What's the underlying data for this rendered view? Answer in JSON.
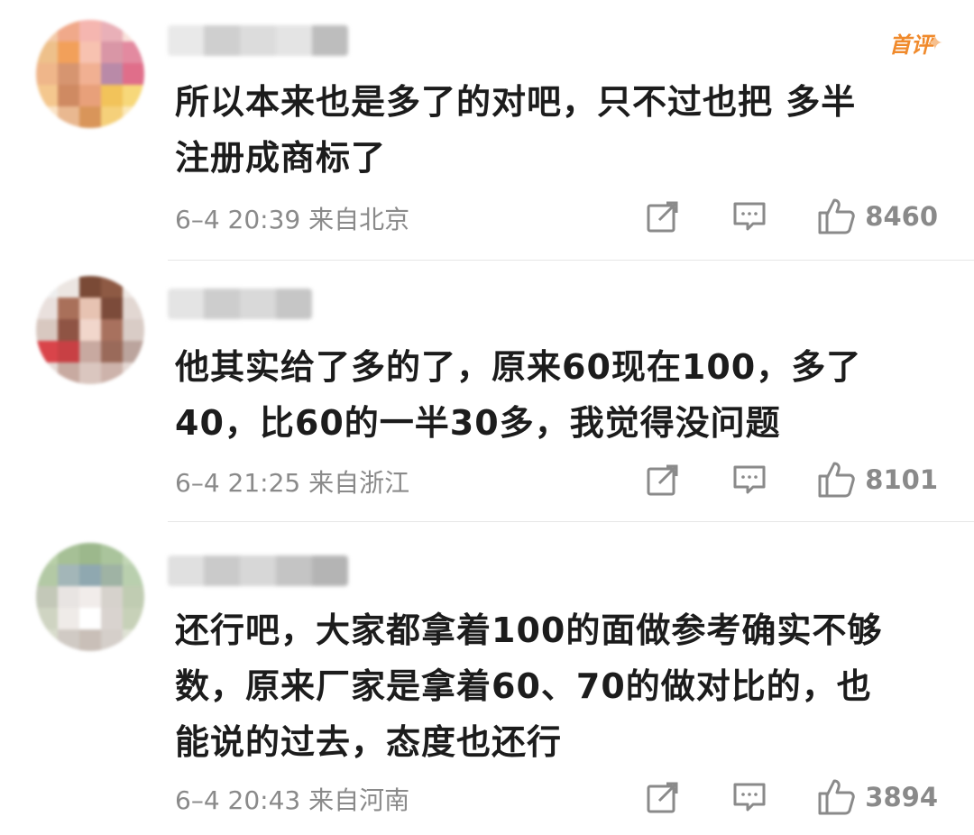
{
  "comments": [
    {
      "badge": "首评",
      "text_lines": [
        "所以本来也是多了的对吧，只不过也把 多半",
        "注册成商标了"
      ],
      "time": "6–4 20:39",
      "location": "来自北京",
      "likes": "8460"
    },
    {
      "text_lines": [
        "他其实给了多的了，原来60现在100，多了",
        "40，比60的一半30多，我觉得没问题"
      ],
      "time": "6–4 21:25",
      "location": "来自浙江",
      "likes": "8101"
    },
    {
      "text_lines": [
        "还行吧，大家都拿着100的面做参考确实不够",
        "数，原来厂家是拿着60、70的做对比的，也",
        "能说的过去，态度也还行"
      ],
      "time": "6–4 20:43",
      "location": "来自河南",
      "likes": "3894"
    }
  ],
  "icons": {
    "share": "share-icon",
    "comment": "comment-icon",
    "like": "thumbs-up-icon"
  },
  "colors": {
    "badge": "#f08a2c",
    "meta": "#8a8a8a",
    "text": "#1c1c1c"
  }
}
